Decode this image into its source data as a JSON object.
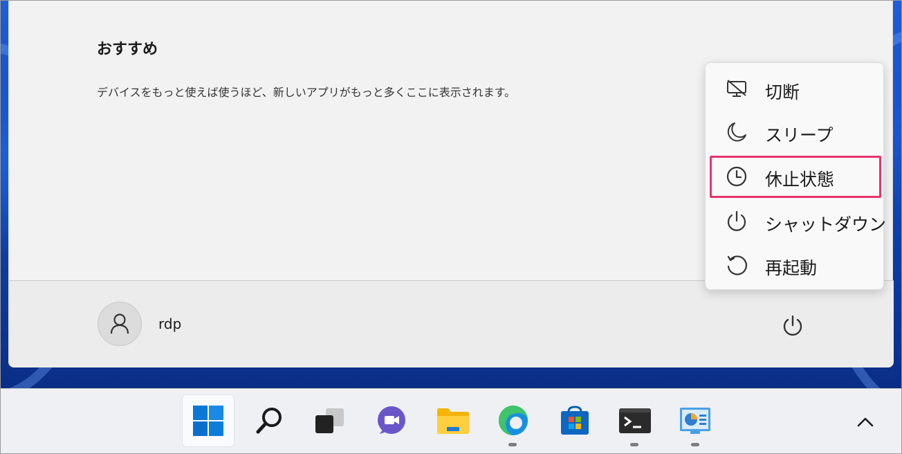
{
  "start_menu": {
    "recommended_title": "おすすめ",
    "recommended_desc": "デバイスをもっと使えば使うほど、新しいアプリがもっと多くここに表示されます。",
    "user_name": "rdp"
  },
  "power_menu": {
    "items": [
      {
        "label": "切断",
        "icon": "disconnect-icon"
      },
      {
        "label": "スリープ",
        "icon": "moon-icon"
      },
      {
        "label": "休止状態",
        "icon": "clock-icon"
      },
      {
        "label": "シャットダウン",
        "icon": "power-icon"
      },
      {
        "label": "再起動",
        "icon": "restart-icon"
      }
    ],
    "highlighted": "休止状態"
  },
  "taskbar": {
    "items": [
      "start-icon",
      "search-icon",
      "task-view-icon",
      "chat-icon",
      "file-explorer-icon",
      "edge-icon",
      "store-icon",
      "terminal-icon",
      "control-panel-icon"
    ],
    "tray": "chevron-up-icon"
  },
  "colors": {
    "highlight": "#e8336c",
    "accent": "#0067c0"
  }
}
